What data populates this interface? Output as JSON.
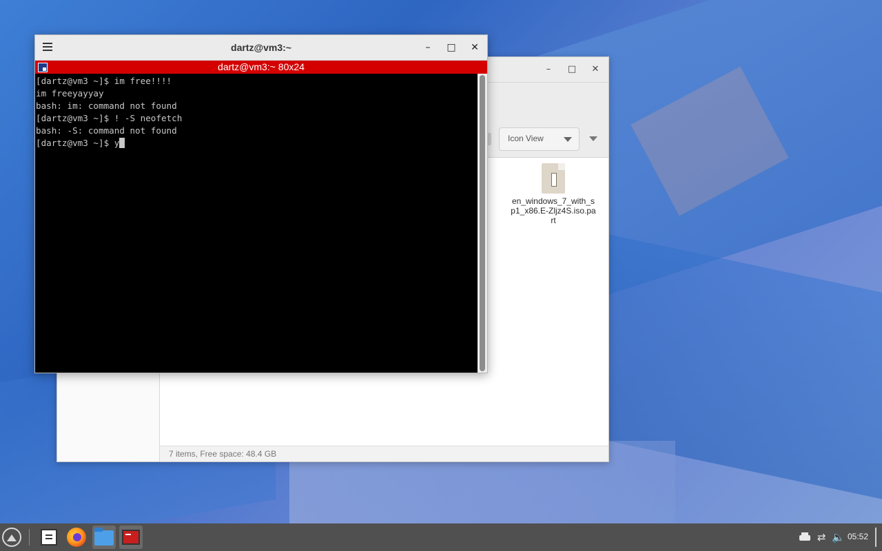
{
  "terminal": {
    "title": "dartz@vm3:~",
    "banner": "dartz@vm3:~ 80x24",
    "lines": [
      "[dartz@vm3 ~]$ im free!!!!",
      "im freeyayyay",
      "bash: im: command not found",
      "[dartz@vm3 ~]$ ! -S neofetch",
      "bash: -S: command not found"
    ],
    "prompt": "[dartz@vm3 ~]$ ",
    "current_input": "y",
    "buttons": {
      "minimize": "–",
      "maximize": "□",
      "close": "✕"
    }
  },
  "file_manager": {
    "buttons": {
      "minimize": "–",
      "maximize": "□",
      "close": "✕"
    },
    "view_mode": "Icon View",
    "file": {
      "name": "en_windows_7_with_sp1_x86.E-Zljz4S.iso.part",
      "icon": "archive-file-icon"
    },
    "status": "7 items, Free space: 48.4 GB"
  },
  "taskbar": {
    "apps": [
      "file-manager",
      "firefox",
      "files",
      "terminal"
    ],
    "clock": "05:52",
    "tray": [
      "printer-icon",
      "network-icon",
      "volume-muted-icon"
    ]
  }
}
